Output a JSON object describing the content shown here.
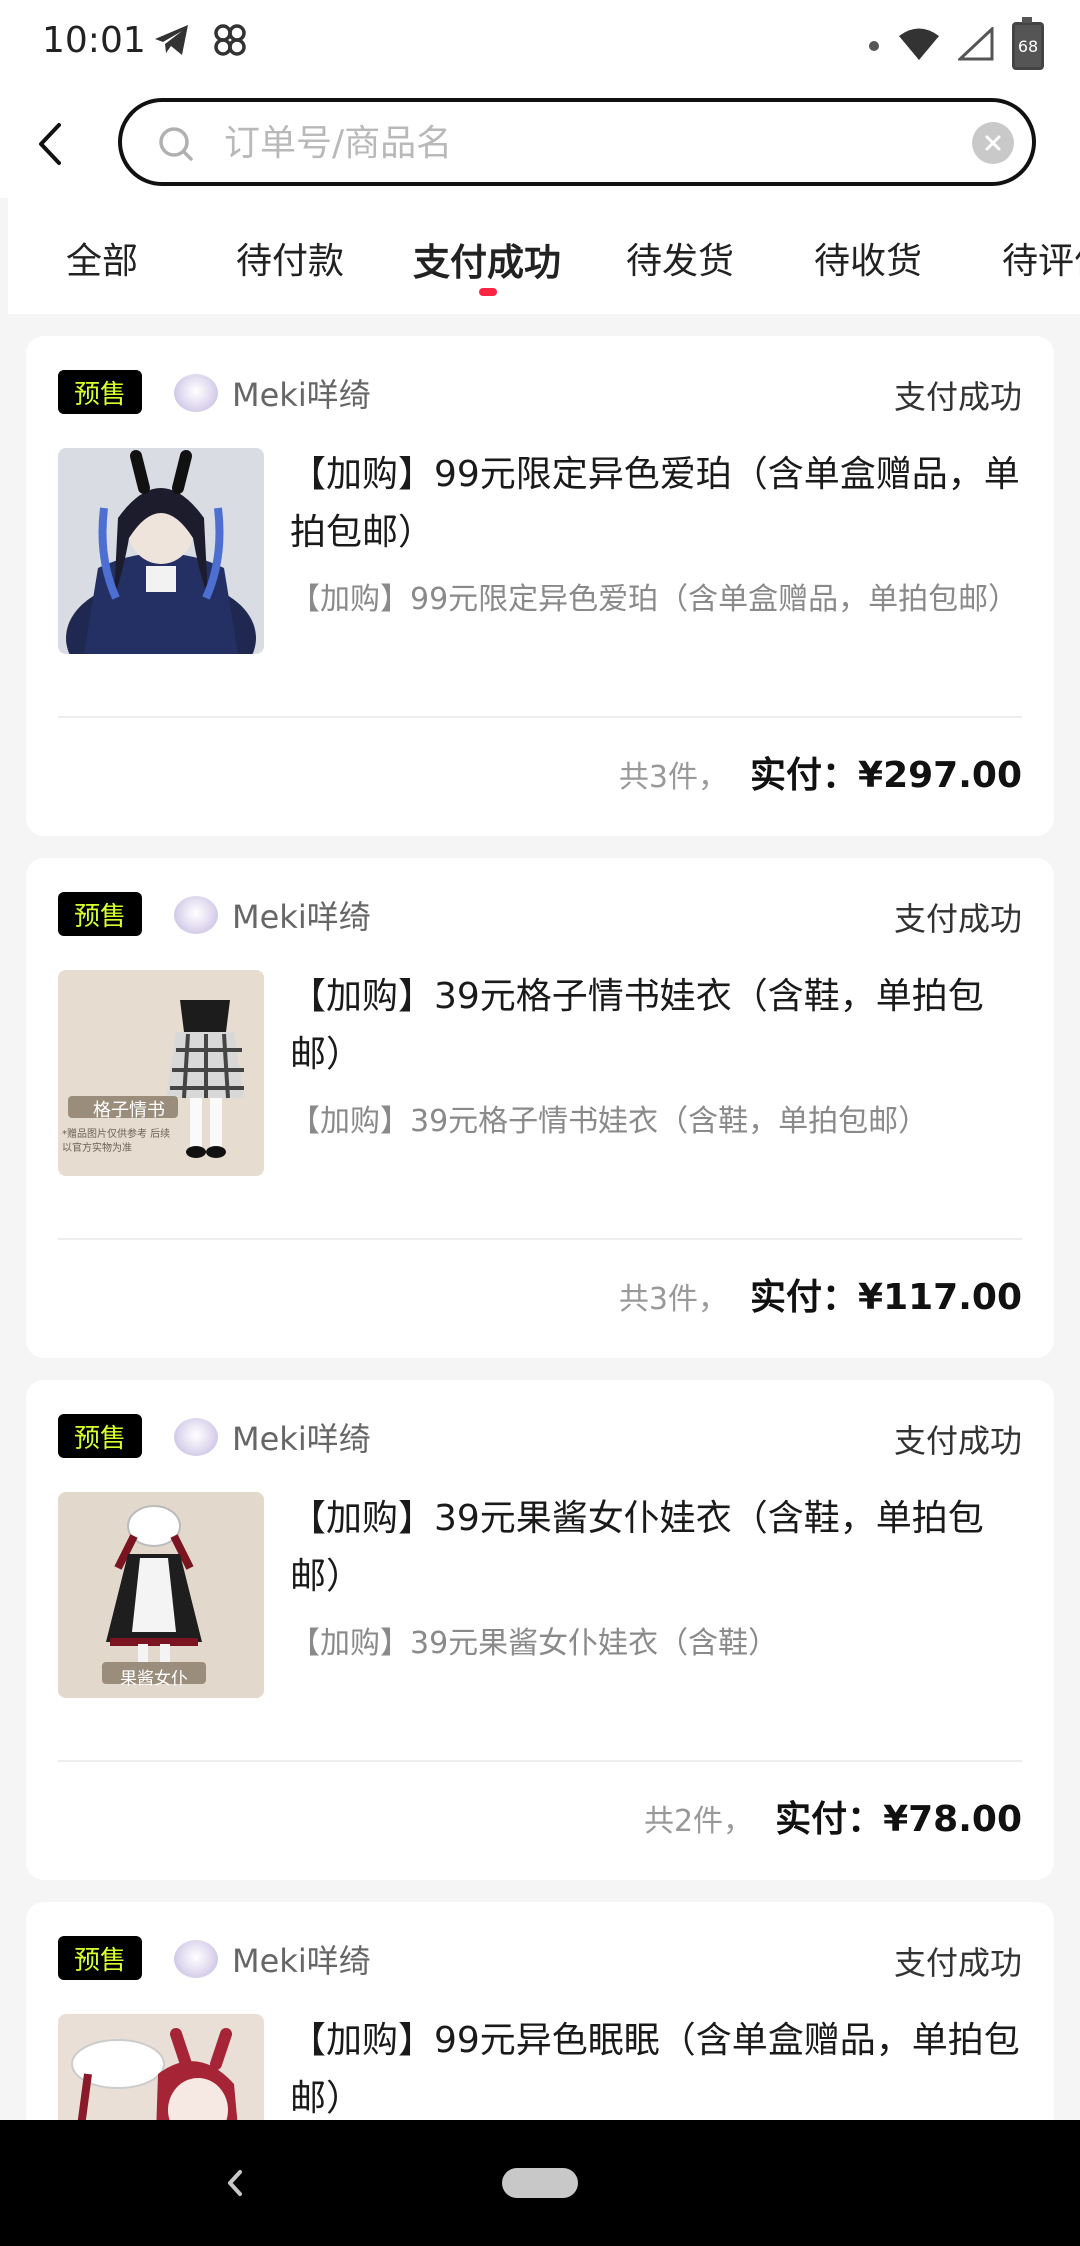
{
  "status_bar": {
    "time": "10:01",
    "battery": "68"
  },
  "search": {
    "placeholder": "订单号/商品名",
    "value": ""
  },
  "tabs": [
    {
      "label": "全部"
    },
    {
      "label": "待付款"
    },
    {
      "label": "支付成功",
      "active": true
    },
    {
      "label": "待发货"
    },
    {
      "label": "待收货"
    },
    {
      "label": "待评价"
    }
  ],
  "orders": [
    {
      "badge": "预售",
      "shop": "Meki咩绮",
      "status": "支付成功",
      "title": "【加购】99元限定异色爱珀（含单盒赠品，单拍包邮）",
      "subtitle": "【加购】99元限定异色爱珀（含单盒赠品，单拍包邮）",
      "count": "共3件，",
      "pay_label": "实付：",
      "pay_amount": "¥297.00"
    },
    {
      "badge": "预售",
      "shop": "Meki咩绮",
      "status": "支付成功",
      "title": "【加购】39元格子情书娃衣（含鞋，单拍包邮）",
      "subtitle": "【加购】39元格子情书娃衣（含鞋，单拍包邮）",
      "image_caption": "格子情书",
      "image_note": "*赠品图片仅供参考 后续以官方实物为准",
      "count": "共3件，",
      "pay_label": "实付：",
      "pay_amount": "¥117.00"
    },
    {
      "badge": "预售",
      "shop": "Meki咩绮",
      "status": "支付成功",
      "title": "【加购】39元果酱女仆娃衣（含鞋，单拍包邮）",
      "subtitle": "【加购】39元果酱女仆娃衣（含鞋）",
      "image_caption": "果酱女仆",
      "count": "共2件，",
      "pay_label": "实付：",
      "pay_amount": "¥78.00"
    },
    {
      "badge": "预售",
      "shop": "Meki咩绮",
      "status": "支付成功",
      "title": "【加购】99元异色眠眠（含单盒赠品，单拍包邮）"
    }
  ],
  "colors": {
    "accent": "#ff2442",
    "badge_bg": "#000000",
    "badge_text": "#d6ff2e"
  }
}
